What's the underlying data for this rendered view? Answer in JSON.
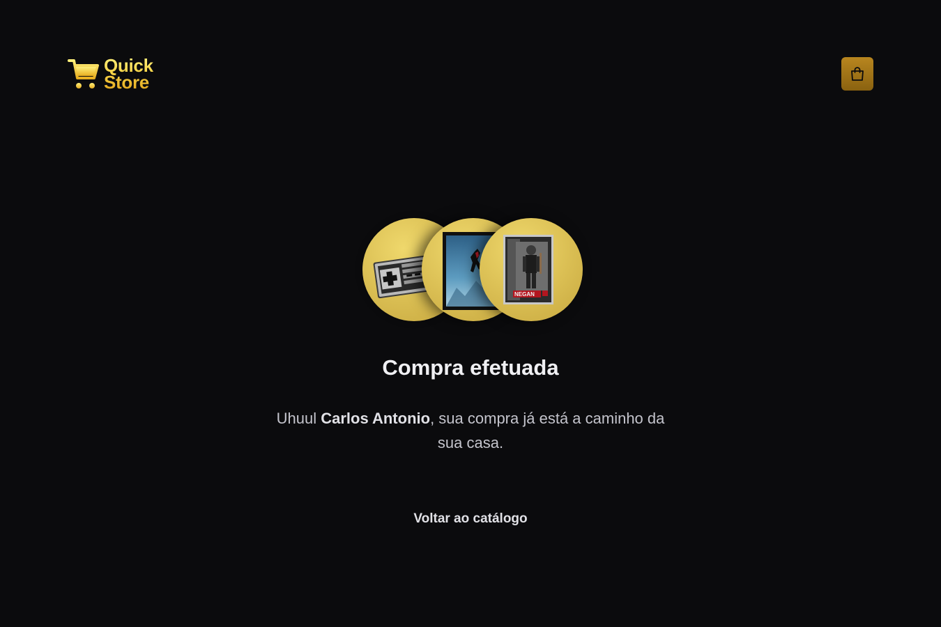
{
  "header": {
    "logo": {
      "icon": "shopping-cart-icon",
      "line1": "Quick",
      "line2": "Store"
    },
    "cart_button": {
      "icon": "shopping-bag-icon",
      "color": "#a57716"
    }
  },
  "products": [
    {
      "name": "nes-controller",
      "icon": "game-controller-image"
    },
    {
      "name": "spider-man-poster",
      "icon": "poster-image"
    },
    {
      "name": "negan-figure-box",
      "icon": "action-figure-box-image",
      "box_text": "NEGAN"
    }
  ],
  "main": {
    "title": "Compra efetuada",
    "message_prefix": "Uhuul ",
    "customer_name": "Carlos Antonio",
    "message_suffix": ", sua compra já está a caminho da sua casa.",
    "back_link": "Voltar ao catálogo"
  },
  "colors": {
    "background": "#0b0b0d",
    "accent_yellow": "#f7d54a",
    "circle_gold": "#d9bd52"
  }
}
